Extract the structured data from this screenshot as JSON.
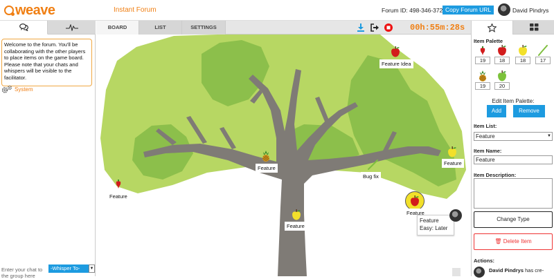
{
  "header": {
    "logo_text": "weave",
    "app_title": "Instant Forum",
    "forum_id": "Forum ID: 498-346-372",
    "copy_button": "Copy Forum URL",
    "user_name": "David Pindrys"
  },
  "left_panel": {
    "tabs": [
      {
        "icon": "chat-bubbles-icon",
        "active": true
      },
      {
        "icon": "activity-pulse-icon",
        "active": false
      }
    ],
    "welcome_message": "Welcome to the forum. You'll be collaborating with the other players to place items on the game board. Please note that your chats and whispers will be visible to the facilitator.",
    "system_label": "System",
    "chat_placeholder": "Enter your chat to the group here",
    "whisper_label": "-Whisper To-"
  },
  "board_tabs": [
    {
      "label": "BOARD",
      "active": true
    },
    {
      "label": "LIST",
      "active": false
    },
    {
      "label": "SETTINGS",
      "active": false
    }
  ],
  "toolbar": {
    "icons": [
      "download-icon",
      "exit-icon",
      "stop-record-icon"
    ],
    "timer": "00h:55m:28s"
  },
  "board": {
    "items": [
      {
        "type": "red-apple",
        "label": "Feature Idea"
      },
      {
        "type": "pineapple",
        "label": "Feature"
      },
      {
        "type": "yellow-apple",
        "label": "Feature"
      },
      {
        "type": "red-pepper",
        "label": "Feature"
      },
      {
        "type": "green-bean",
        "label": "Bug fix"
      },
      {
        "type": "yellow-apple",
        "label": "Feature"
      },
      {
        "type": "red-apple",
        "label": "Feature"
      }
    ],
    "tooltip": {
      "title": "Feature",
      "detail": "Easy: Later"
    }
  },
  "right_panel": {
    "tabs": [
      {
        "icon": "star-icon",
        "active": true
      },
      {
        "icon": "grid-icon",
        "active": false
      }
    ],
    "item_palette_label": "Item Palette",
    "palette": [
      {
        "type": "red-pepper",
        "count": "19"
      },
      {
        "type": "red-apple",
        "count": "18"
      },
      {
        "type": "yellow-apple",
        "count": "18"
      },
      {
        "type": "green-bean",
        "count": "17"
      },
      {
        "type": "pineapple",
        "count": "19"
      },
      {
        "type": "green-apple",
        "count": "20"
      }
    ],
    "edit_palette_label": "Edit Item Palette:",
    "add_button": "Add",
    "remove_button": "Remove",
    "item_list_label": "Item List:",
    "item_list_value": "Feature",
    "item_name_label": "Item Name:",
    "item_name_value": "Feature",
    "item_description_label": "Item Description:",
    "change_type_button": "Change Type",
    "delete_item_button": "Delete Item",
    "actions_label": "Actions:",
    "actions_author": "David Pindrys",
    "actions_text": "has cre-"
  },
  "colors": {
    "brand_orange": "#f07f13",
    "accent_blue": "#1d9be0",
    "leaf_light": "#b7d763",
    "leaf_dark": "#8cbf4b",
    "trunk": "#7f7b76",
    "delete_red": "#e33333"
  }
}
